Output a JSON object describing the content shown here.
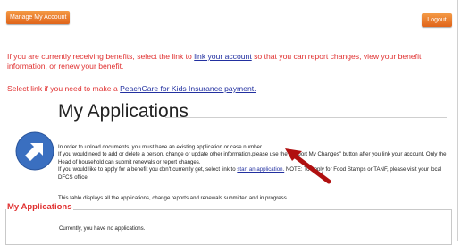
{
  "header": {
    "manage_account_label": "Manage My Account",
    "logout_label": "Logout"
  },
  "notices": {
    "benefits_before": "If you are currently receiving benefits, select the link to ",
    "benefits_link": "link your account",
    "benefits_after": " so that you can report changes, view your benefit information, or renew your benefit.",
    "peachcare_before": "Select link if you need to make a ",
    "peachcare_link": "PeachCare for Kids Insurance payment."
  },
  "main": {
    "title": "My Applications",
    "info_upload": "In order to upload documents, you must have an existing application or case number.",
    "info_changes": "If you would need to add or delete a person, change or update other information,please use the \"Report My Changes\" button after you link your account. Only the Head of household can submit renewals or report changes.",
    "info_apply_before": "If you would like to apply for a benefit you don't currently get, select link to ",
    "info_apply_link": "start an application.",
    "info_apply_after": " NOTE: To apply for Food Stamps or TANF, please visit your local DFCS office.",
    "info_table": "This table displays all the applications, change reports and renewals submitted and in progress."
  },
  "applications": {
    "legend": "My Applications",
    "empty_message": "Currently, you have no applications."
  },
  "icons": {
    "logo": "diagonal-arrow-circle-icon",
    "pointer": "red-arrow-icon"
  },
  "colors": {
    "accent_orange": "#e8782a",
    "notice_red": "#e03030",
    "link_blue": "#2230a0",
    "icon_blue": "#3a6fc0"
  }
}
